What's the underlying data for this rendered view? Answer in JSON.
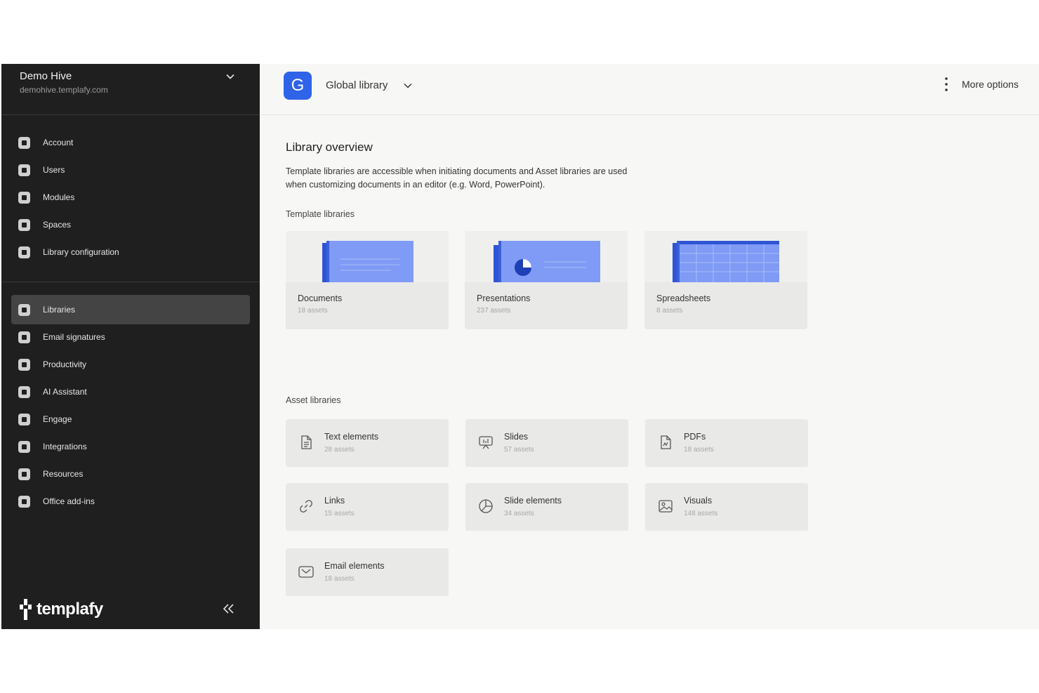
{
  "workspace": {
    "name": "Demo Hive",
    "url": "demohive.templafy.com"
  },
  "nav_top": [
    {
      "label": "Account",
      "icon": "account-icon"
    },
    {
      "label": "Users",
      "icon": "users-icon"
    },
    {
      "label": "Modules",
      "icon": "modules-icon"
    },
    {
      "label": "Spaces",
      "icon": "spaces-icon"
    },
    {
      "label": "Library configuration",
      "icon": "settings-icon"
    }
  ],
  "nav_main": [
    {
      "label": "Libraries",
      "icon": "libraries-icon",
      "active": true
    },
    {
      "label": "Email signatures",
      "icon": "email-signature-icon"
    },
    {
      "label": "Productivity",
      "icon": "productivity-icon"
    },
    {
      "label": "AI Assistant",
      "icon": "ai-sparkle-icon"
    },
    {
      "label": "Engage",
      "icon": "engage-icon"
    },
    {
      "label": "Integrations",
      "icon": "integrations-icon"
    },
    {
      "label": "Resources",
      "icon": "resources-icon"
    },
    {
      "label": "Office add-ins",
      "icon": "office-addins-icon"
    }
  ],
  "brand": {
    "name": "templafy"
  },
  "header": {
    "badge_letter": "G",
    "library_name": "Global library",
    "more_options": "More options"
  },
  "overview": {
    "title": "Library overview",
    "description": "Template libraries are accessible when initiating documents and Asset libraries are used when customizing documents in an editor (e.g. Word, PowerPoint)."
  },
  "template_libraries": {
    "label": "Template libraries",
    "items": [
      {
        "title": "Documents",
        "count": "18 assets"
      },
      {
        "title": "Presentations",
        "count": "237 assets"
      },
      {
        "title": "Spreadsheets",
        "count": "8 assets"
      }
    ]
  },
  "asset_libraries": {
    "label": "Asset libraries",
    "items": [
      {
        "title": "Text elements",
        "count": "28 assets",
        "icon": "text-document-icon"
      },
      {
        "title": "Slides",
        "count": "57 assets",
        "icon": "slides-icon"
      },
      {
        "title": "PDFs",
        "count": "18 assets",
        "icon": "pdf-icon"
      },
      {
        "title": "Links",
        "count": "15 assets",
        "icon": "link-icon"
      },
      {
        "title": "Slide elements",
        "count": "34 assets",
        "icon": "pie-chart-icon"
      },
      {
        "title": "Visuals",
        "count": "148 assets",
        "icon": "image-icon"
      },
      {
        "title": "Email elements",
        "count": "18 assets",
        "icon": "envelope-icon"
      }
    ]
  },
  "colors": {
    "sidebar_bg": "#1f1f1f",
    "accent_blue": "#2f63e8",
    "illustration_blue": "#7f9bf5"
  }
}
